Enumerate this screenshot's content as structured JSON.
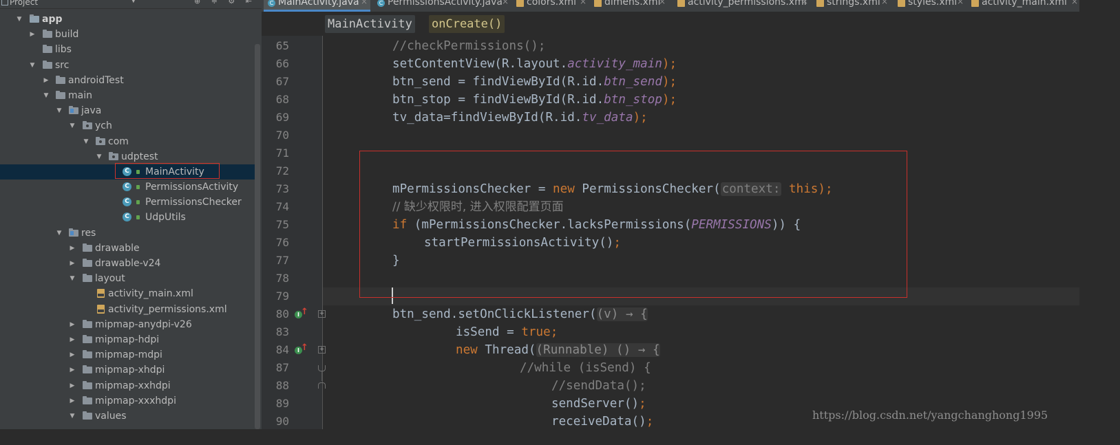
{
  "project_panel": {
    "title": "Project",
    "tree": [
      {
        "label": "app",
        "bold": true
      },
      {
        "label": "build"
      },
      {
        "label": "libs"
      },
      {
        "label": "src"
      },
      {
        "label": "androidTest"
      },
      {
        "label": "main"
      },
      {
        "label": "java"
      },
      {
        "label": "ych"
      },
      {
        "label": "com"
      },
      {
        "label": "udptest"
      },
      {
        "label": "MainActivity",
        "selected": true
      },
      {
        "label": "PermissionsActivity"
      },
      {
        "label": "PermissionsChecker"
      },
      {
        "label": "UdpUtils"
      },
      {
        "label": "res"
      },
      {
        "label": "drawable"
      },
      {
        "label": "drawable-v24"
      },
      {
        "label": "layout"
      },
      {
        "label": "activity_main.xml"
      },
      {
        "label": "activity_permissions.xml"
      },
      {
        "label": "mipmap-anydpi-v26"
      },
      {
        "label": "mipmap-hdpi"
      },
      {
        "label": "mipmap-mdpi"
      },
      {
        "label": "mipmap-xhdpi"
      },
      {
        "label": "mipmap-xxhdpi"
      },
      {
        "label": "mipmap-xxxhdpi"
      },
      {
        "label": "values"
      }
    ]
  },
  "tabs": [
    {
      "label": "MainActivity.java",
      "active": true,
      "icon": "class-icon"
    },
    {
      "label": "PermissionsActivity.java",
      "icon": "class-icon"
    },
    {
      "label": "colors.xml",
      "icon": "xml-icon"
    },
    {
      "label": "dimens.xml",
      "icon": "xml-icon"
    },
    {
      "label": "activity_permissions.xml",
      "icon": "xml-icon"
    },
    {
      "label": "strings.xml",
      "icon": "xml-icon"
    },
    {
      "label": "styles.xml",
      "icon": "xml-icon"
    },
    {
      "label": "activity_main.xml",
      "icon": "xml-icon"
    }
  ],
  "breadcrumb": {
    "class": "MainActivity",
    "method": "onCreate()"
  },
  "editor": {
    "line_numbers": [
      "65",
      "66",
      "67",
      "68",
      "69",
      "70",
      "71",
      "72",
      "73",
      "74",
      "75",
      "76",
      "77",
      "78",
      "79",
      "80",
      "83",
      "84",
      "87",
      "88",
      "89",
      "90"
    ],
    "code": {
      "l65": "//checkPermissions();",
      "l66_a": "setContentView(R.layout.",
      "l66_b": "activity_main",
      "l66_c": ");",
      "l67_a": "btn_send = findViewById(R.id.",
      "l67_b": "btn_send",
      "l67_c": ");",
      "l68_a": "btn_stop = findViewById(R.id.",
      "l68_b": "btn_stop",
      "l68_c": ");",
      "l69_a": "tv_data=findViewById(R.id.",
      "l69_b": "tv_data",
      "l69_c": ");",
      "l73_a": "mPermissionsChecker = ",
      "l73_kw": "new",
      "l73_b": " PermissionsChecker(",
      "l73_hint": "context:",
      "l73_this": " this",
      "l73_c": ");",
      "l74": "// 缺少权限时, 进入权限配置页面",
      "l75_kw": "if",
      "l75_a": " (mPermissionsChecker.lacksPermissions(",
      "l75_const": "PERMISSIONS",
      "l75_b": ")) {",
      "l76_a": "startPermissionsActivity()",
      "l76_b": ";",
      "l77": "}",
      "l80_a": "btn_send.setOnClickListener(",
      "l80_lam": "(v) → {",
      "l83_a": "isSend = ",
      "l83_kw": "true",
      "l83_b": ";",
      "l84_kw": "new",
      "l84_a": " Thread(",
      "l84_lam": "(Runnable) () → {",
      "l87": "//while (isSend) {",
      "l88": "//sendData();",
      "l89_a": "sendServer()",
      "l89_b": ";",
      "l90_a": "receiveData()",
      "l90_b": ";"
    }
  },
  "watermark": "https://blog.csdn.net/yangchanghong1995",
  "colors": {
    "keyword": "#cc7832",
    "field": "#9876aa",
    "comment": "#808080",
    "text": "#a9b7c6",
    "highlight_border": "#c9302c",
    "selection_border": "#d0342c"
  }
}
